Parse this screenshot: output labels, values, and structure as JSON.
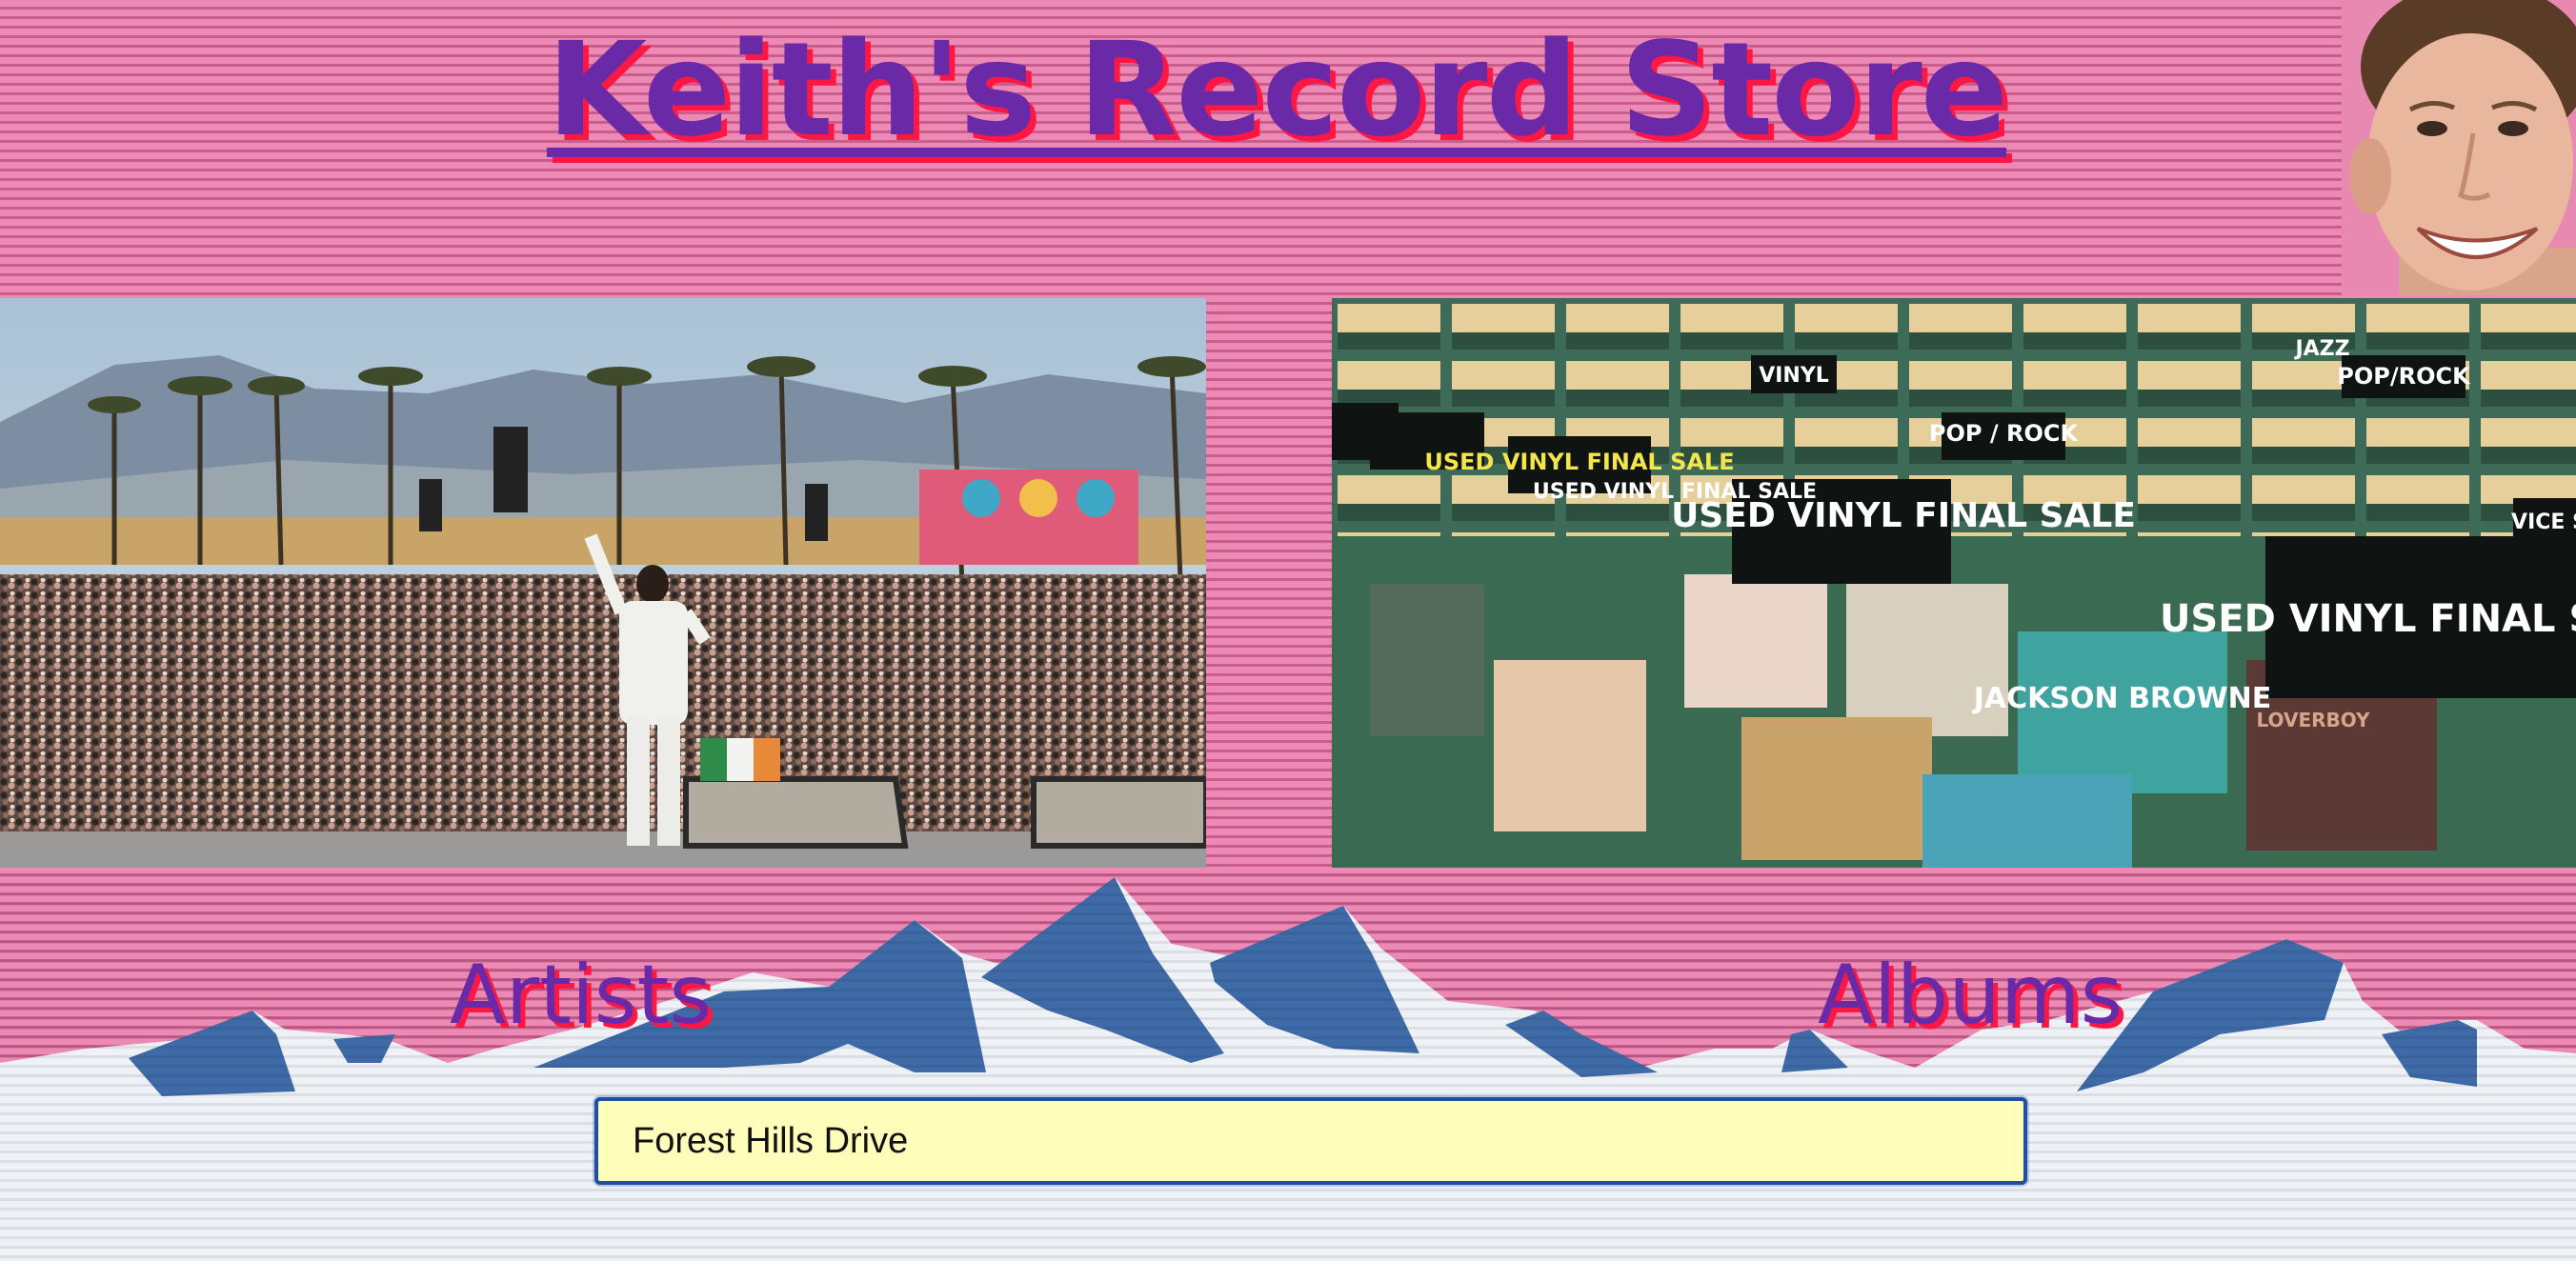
{
  "header": {
    "title": "Keith's Record Store"
  },
  "nav": {
    "artists_label": "Artists",
    "albums_label": "Albums"
  },
  "search": {
    "value": "Forest Hills Drive",
    "placeholder": ""
  },
  "images": {
    "store_signs": [
      "USED VINYL FINAL SALE",
      "USED VINYL FINAL SALE",
      "USED VINYL FINAL SALE",
      "USED VINYL FINAL SALE",
      "POP / ROCK",
      "POP/ROCK",
      "JAZZ",
      "VINYL",
      "VICE S"
    ],
    "album_label": "JACKSON BROWNE",
    "album_label_2": "LOVERBOY"
  },
  "colors": {
    "title": "#6a2aa8",
    "title_shadow": "#ff1744",
    "stripe_light": "#ec89b5",
    "stripe_dark": "#c95d8d",
    "search_bg": "#fefdb9",
    "search_border": "#1d4fa3",
    "mountain_blue": "#3f6aa8",
    "snow": "#eef1f6"
  }
}
